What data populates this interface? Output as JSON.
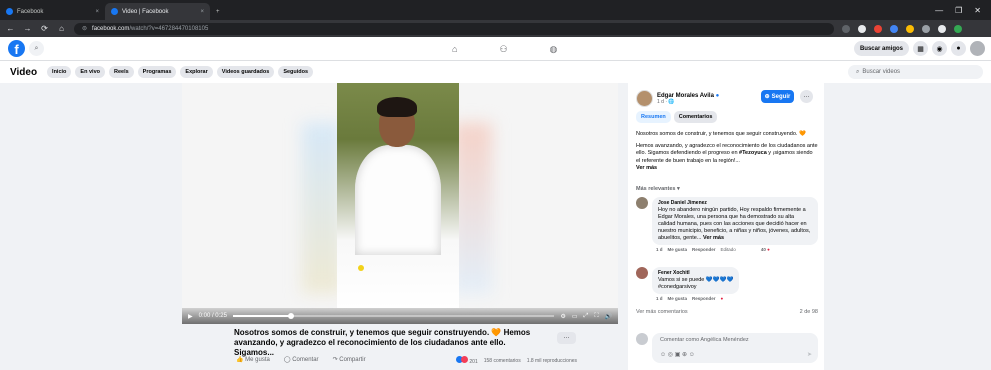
{
  "browser": {
    "tabs": [
      {
        "label": "Facebook",
        "close": "×"
      },
      {
        "label": "Video | Facebook",
        "close": "×"
      }
    ],
    "new_tab": "+",
    "window_controls": [
      "—",
      "❐",
      "✕"
    ],
    "url_prefix": "facebook.com",
    "url_path": "/watch/?v=467284470108105",
    "nav": [
      "←",
      "→",
      "⟳",
      "⌂"
    ]
  },
  "fb_header": {
    "logo": "f",
    "nav_icons": [
      "home-icon",
      "friends-icon",
      "groups-icon"
    ],
    "nav_glyphs": [
      "⌂",
      "⚇",
      "◍"
    ],
    "find_friends": "Buscar amigos",
    "menu_glyph": "▦",
    "messenger_glyph": "◉",
    "bell_glyph": "●"
  },
  "video_nav": {
    "title": "Video",
    "chips": [
      "Inicio",
      "En vivo",
      "Reels",
      "Programas",
      "Explorar",
      "Videos guardados",
      "Seguidos"
    ],
    "search_placeholder": "Buscar videos"
  },
  "player": {
    "progress": 0.18,
    "time": "0:00 / 0:25",
    "play": "▶",
    "icons": [
      "⚙",
      "▭",
      "⤢",
      "⛶",
      "🔊"
    ]
  },
  "post": {
    "caption": "Nosotros somos de construir, y tenemos que seguir construyendo. 🧡 Hemos avanzando, y agradezco el reconocimiento de los ciudadanos ante ello. Sigamos...",
    "more": "···",
    "like": "👍 Me gusta",
    "comment": "◯ Comentar",
    "share": "↷ Compartir",
    "reactions_count": "201",
    "comments_count": "158 comentarios",
    "views": "1.8 mil reproducciones"
  },
  "panel": {
    "author": "Edgar Morales Avila",
    "time": "1 d · 🌐",
    "follow": "Seguir",
    "more": "···",
    "tabs": [
      "Resumen",
      "Comentarios"
    ],
    "desc_line1": "Nosotros somos de construir, y tenemos que seguir construyendo. 🧡",
    "desc_line2a": "Hemos avanzando, y agradezco el reconocimiento de los ciudadanos ante ello. Sigamos defendiendo el progreso en ",
    "desc_hashtag": "#Tezoyuca",
    "desc_line2b": " y ¡sigamos siendo el referente de buen trabajo en la región!...",
    "see_more": "Ver más",
    "relevant": "Más relevantes ▾",
    "comments": [
      {
        "name": "Jose Daniel Jimenez",
        "text": "Hoy no abandero ningún partido, Hoy respaldo firmemente a Edgar Morales, una persona que ha demostrado su alta calidad humana, pues con las acciones que decidió hacer en nuestro municipio, beneficio, a niñas y niños, jóvenes, adultos, abuelitos, gente...",
        "see_more": "Ver más",
        "time": "1 d",
        "like": "Me gusta",
        "reply": "Responder",
        "edited": "Editado",
        "reactions": "40"
      },
      {
        "name": "Fener Xochitl",
        "text": "Vamos si se puede 💙💙💙💙",
        "hashtag": "#conedgarsivoy",
        "time": "1 d",
        "like": "Me gusta",
        "reply": "Responder"
      }
    ],
    "more_comments": "Ver más comentarios",
    "count": "2 de 98",
    "composer_placeholder": "Comentar como Angélica Menéndez",
    "composer_icons": "☺ ◎ ▣ ⊕ ☺",
    "send": "➤"
  },
  "colors": {
    "fb_blue": "#1877f2",
    "chrome_dark": "#202124",
    "bg": "#f0f2f5"
  }
}
